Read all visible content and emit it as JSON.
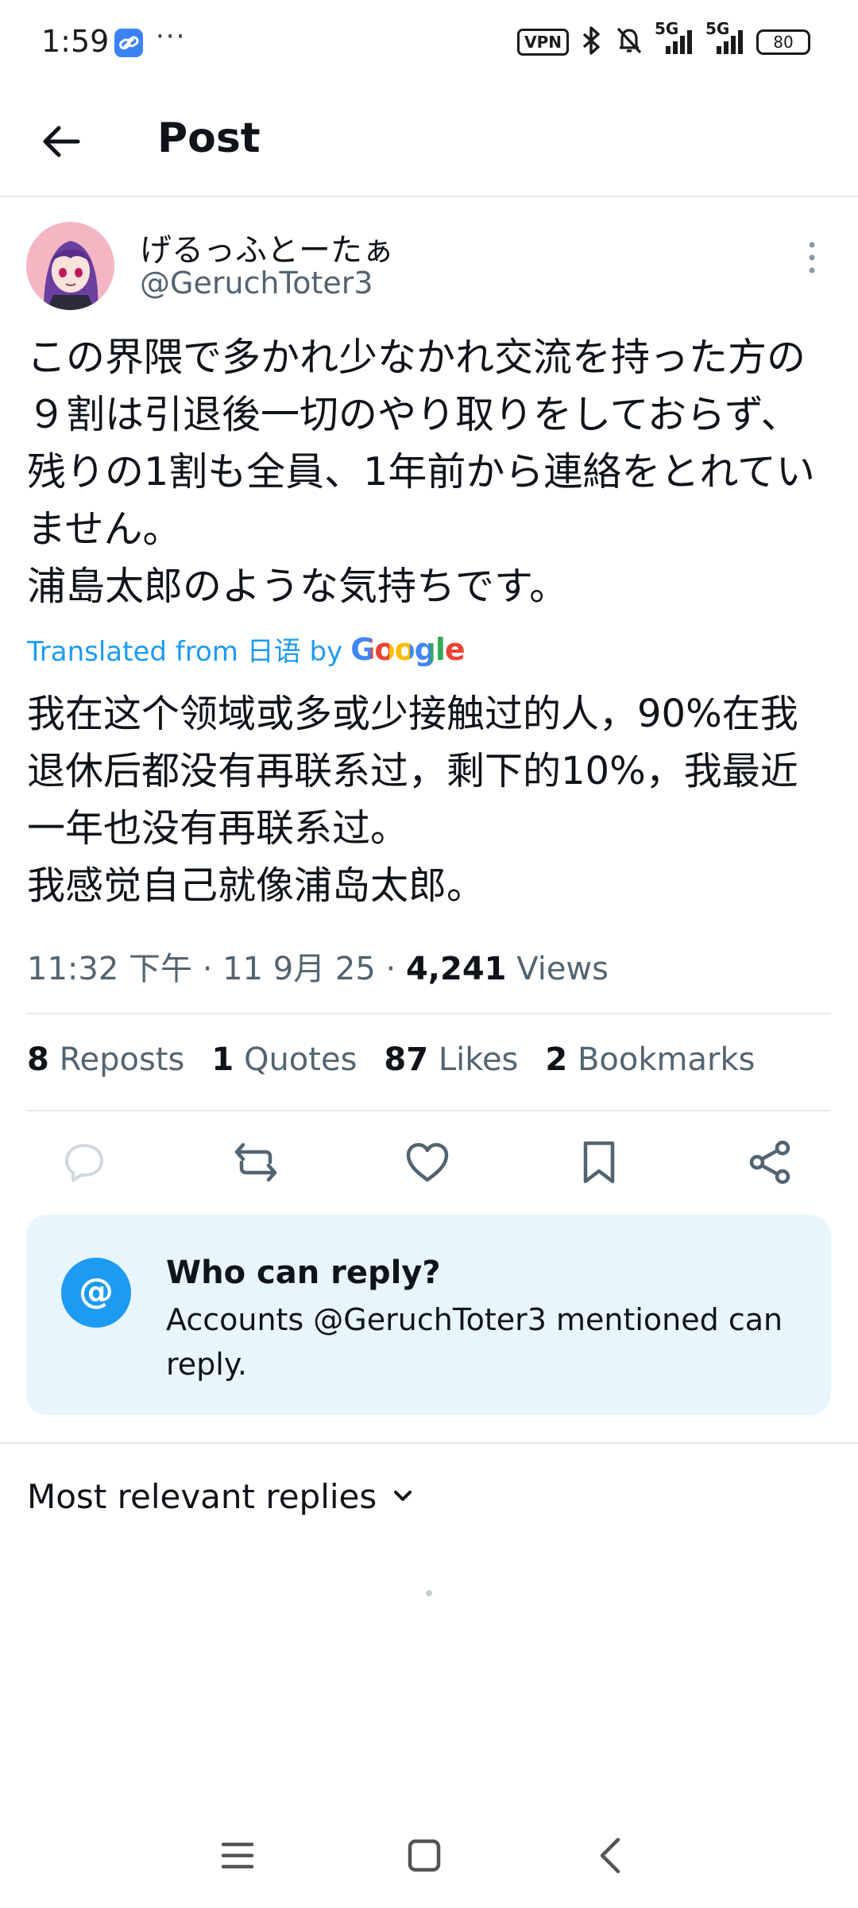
{
  "status_bar": {
    "time": "1:59",
    "more": "···",
    "vpn": "VPN",
    "network1": "5G",
    "network2": "5G",
    "battery": "80"
  },
  "app_bar": {
    "title": "Post"
  },
  "author": {
    "display_name": "げるっふとーたぁ",
    "handle": "@GeruchToter3"
  },
  "post": {
    "text": "この界隈で多かれ少なかれ交流を持った方の\n９割は引退後一切のやり取りをしておらず、\n残りの1割も全員、1年前から連絡をとれてい\nません。\n浦島太郎のような気持ちです。",
    "translated_label": "Translated from 日语 by",
    "translated_provider": "Google",
    "translation": "我在这个领域或多或少接触过的人，90%在我\n退休后都没有再联系过，剩下的10%，我最近\n一年也没有再联系过。\n我感觉自己就像浦岛太郎。",
    "time": "11:32 下午 · 11 9月 25 ·",
    "views_count": "4,241",
    "views_label": "Views"
  },
  "stats": {
    "reposts_count": "8",
    "reposts_label": "Reposts",
    "quotes_count": "1",
    "quotes_label": "Quotes",
    "likes_count": "87",
    "likes_label": "Likes",
    "bookmarks_count": "2",
    "bookmarks_label": "Bookmarks"
  },
  "actions": [
    "reply-icon",
    "repost-icon",
    "like-icon",
    "bookmark-icon",
    "share-icon"
  ],
  "reply_restriction": {
    "badge": "@",
    "title": "Who can reply?",
    "description": "Accounts @GeruchToter3 mentioned can reply."
  },
  "replies": {
    "sort_label": "Most relevant replies"
  },
  "colors": {
    "accent": "#1d9bf0",
    "secondary_text": "#536471",
    "card_bg": "#e8f5fd"
  }
}
